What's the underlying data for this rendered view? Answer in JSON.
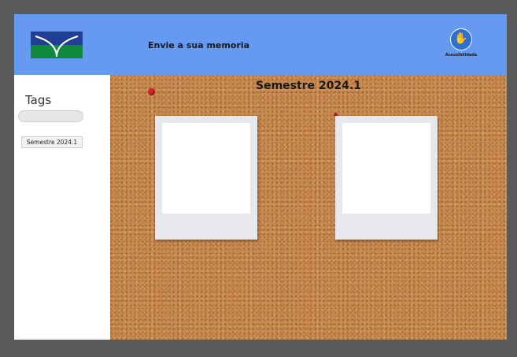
{
  "header": {
    "title": "Envie a sua memoria",
    "logo_icon": "unb-logo-icon",
    "accessibility": {
      "icon": "accessibility-hands-icon",
      "label": "Acessibilidade"
    },
    "colors": {
      "background": "#6699f0"
    }
  },
  "sidebar": {
    "title": "Tags",
    "search": {
      "value": "",
      "placeholder": ""
    },
    "tags": [
      "Semestre 2024.1"
    ]
  },
  "board": {
    "title": "Semestre 2024.1",
    "texture": "cork",
    "cards": [
      {
        "pin_icon": "pushpin-icon"
      },
      {
        "pin_icon": "pushpin-icon"
      }
    ]
  }
}
